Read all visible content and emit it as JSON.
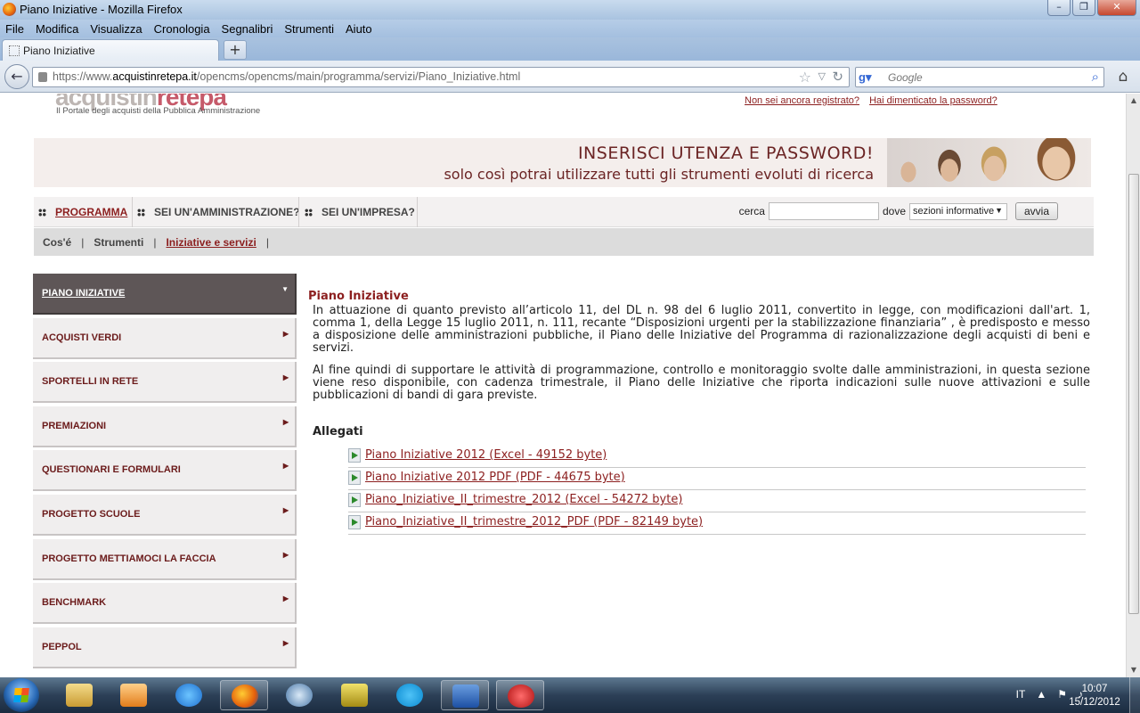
{
  "window": {
    "title": "Piano Iniziative - Mozilla Firefox"
  },
  "menu": [
    "File",
    "Modifica",
    "Visualizza",
    "Cronologia",
    "Segnalibri",
    "Strumenti",
    "Aiuto"
  ],
  "tab": {
    "title": "Piano Iniziative",
    "new_tab": "+"
  },
  "urlbar": {
    "prefix": "https://www.",
    "domain": "acquistinretepa.it",
    "path": "/opencms/opencms/main/programma/servizi/Piano_Iniziative.html"
  },
  "searchbar": {
    "placeholder": "Google"
  },
  "site": {
    "logo": "acquistinretepa",
    "tagline": "Il Portale degli acquisti della Pubblica Amministrazione",
    "links": [
      "Non sei ancora registrato?",
      "Hai dimenticato la password?"
    ],
    "banner": {
      "line1": "INSERISCI UTENZA E PASSWORD!",
      "line2": "solo così potrai utilizzare tutti gli strumenti evoluti di ricerca"
    },
    "mainnav": [
      "PROGRAMMA",
      "SEI UN'AMMINISTRAZIONE?",
      "SEI UN'IMPRESA?"
    ],
    "search": {
      "label": "cerca",
      "value": "",
      "where_label": "dove",
      "where_value": "sezioni informative",
      "button": "avvia"
    },
    "subnav": [
      "Cos'é",
      "Strumenti",
      "Iniziative e servizi"
    ],
    "sidebar": [
      "PIANO INIZIATIVE",
      "ACQUISTI VERDI",
      "SPORTELLI IN RETE",
      "PREMIAZIONI",
      "QUESTIONARI E FORMULARI",
      "PROGETTO SCUOLE",
      "PROGETTO METTIAMOCI LA FACCIA",
      "BENCHMARK",
      "PEPPOL"
    ],
    "content": {
      "title": "Piano Iniziative",
      "p1": "In attuazione di quanto previsto all’articolo 11, del DL n. 98 del 6 luglio 2011, convertito in legge, con modificazioni dall'art. 1, comma 1, della Legge 15 luglio 2011, n. 111, recante “Disposizioni urgenti per la stabilizzazione finanziaria” , è predisposto e messo a disposizione delle amministrazioni pubbliche, il Piano delle Iniziative del Programma di razionalizzazione degli acquisti di beni e servizi.",
      "p2": "Al fine quindi di supportare le attività di programmazione, controllo e monitoraggio svolte dalle amministrazioni, in questa sezione viene reso disponibile, con cadenza trimestrale, il Piano delle Iniziative che riporta indicazioni sulle nuove attivazioni e sulle pubblicazioni di bandi di gara previste.",
      "attachments_title": "Allegati",
      "attachments": [
        "Piano Iniziative 2012 (Excel - 49152 byte)",
        "Piano Iniziative 2012 PDF (PDF - 44675 byte)",
        "Piano_Iniziative_II_trimestre_2012 (Excel - 54272 byte)",
        "Piano_Iniziative_II_trimestre_2012_PDF (PDF - 82149 byte)"
      ]
    }
  },
  "taskbar": {
    "lang": "IT",
    "time": "10:07",
    "date": "15/12/2012"
  },
  "colors": {
    "brand": "#8c1f1f",
    "active_sidebar": "#5e5657"
  }
}
